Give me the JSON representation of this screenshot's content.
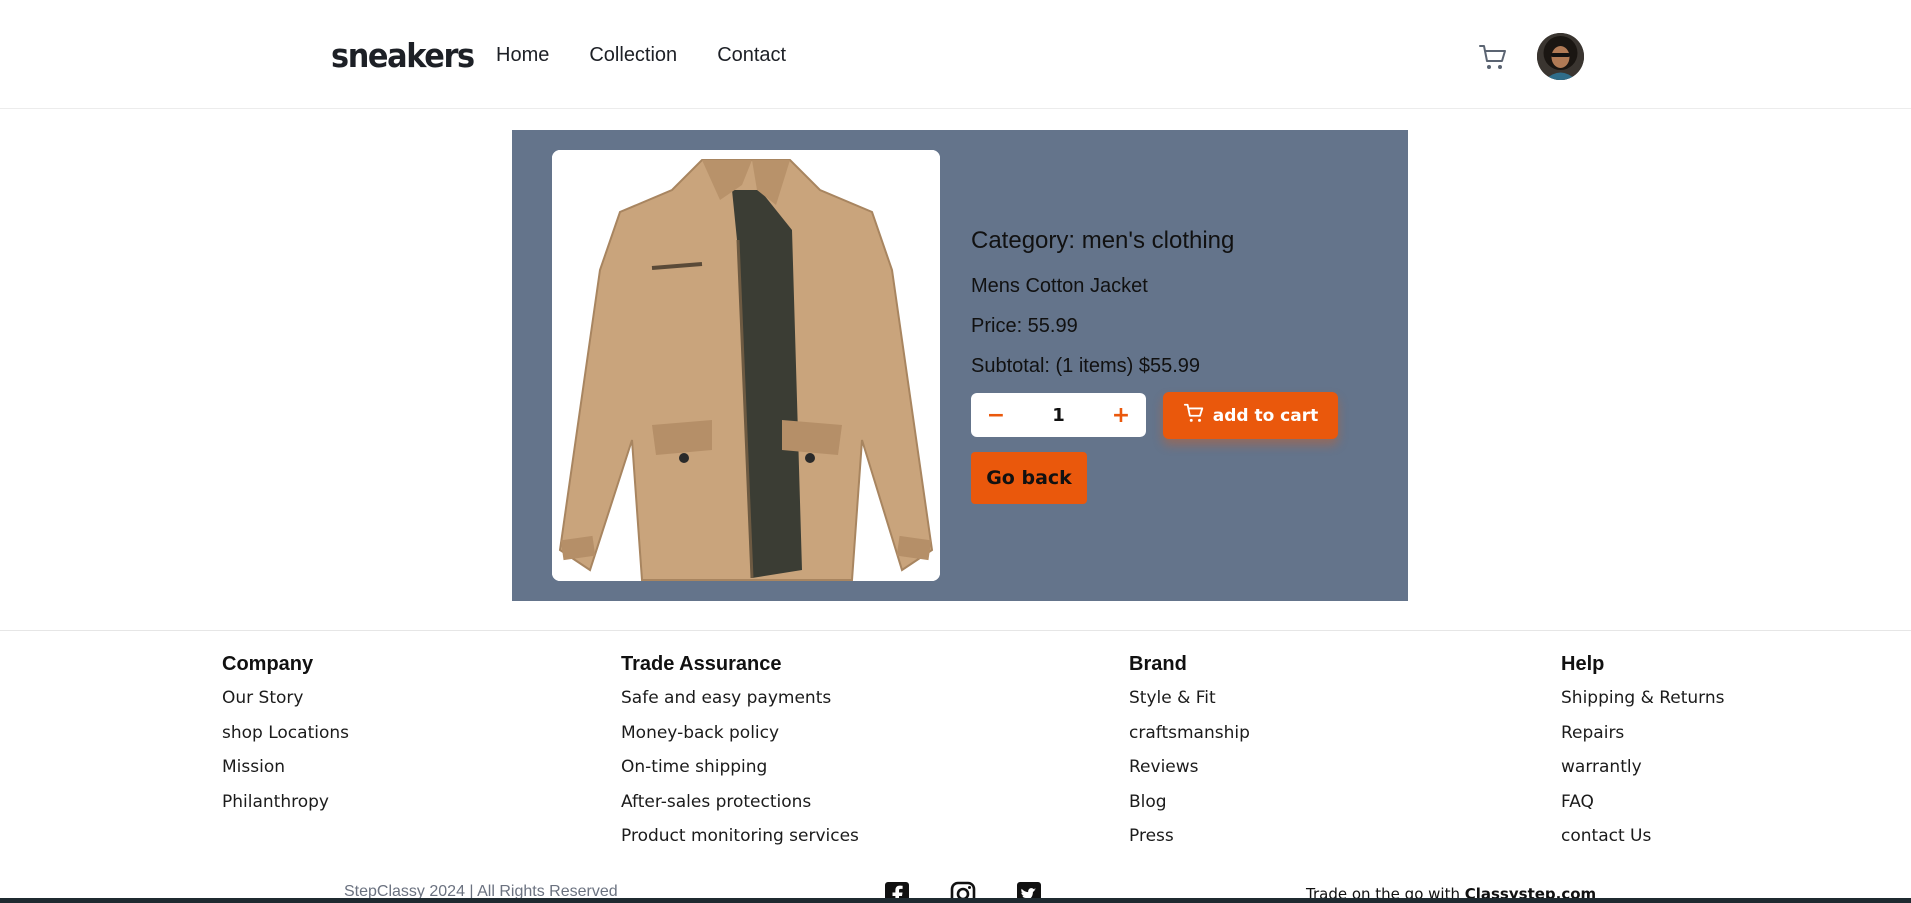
{
  "header": {
    "logo": "sneakers",
    "nav": [
      "Home",
      "Collection",
      "Contact"
    ]
  },
  "product": {
    "category": "Category: men's clothing",
    "title": "Mens Cotton Jacket",
    "price": "Price: 55.99",
    "subtotal": "Subtotal: (1 items) $55.99",
    "quantity": "1",
    "minus": "−",
    "plus": "+",
    "add_to_cart": "add to cart",
    "go_back": "Go back"
  },
  "footer": {
    "company": {
      "title": "Company",
      "items": [
        "Our Story",
        "shop Locations",
        "Mission",
        "Philanthropy"
      ]
    },
    "trade": {
      "title": "Trade Assurance",
      "items": [
        "Safe and easy payments",
        "Money-back policy",
        "On-time shipping",
        "After-sales protections",
        "Product monitoring services"
      ]
    },
    "brand": {
      "title": "Brand",
      "items": [
        "Style & Fit",
        "craftsmanship",
        "Reviews",
        "Blog",
        "Press"
      ]
    },
    "help": {
      "title": "Help",
      "items": [
        "Shipping & Returns",
        "Repairs",
        "warrantly",
        "FAQ",
        "contact Us"
      ]
    },
    "copyright": "StepClassy 2024 | All Rights Reserved",
    "trade_go_prefix": "Trade on the go with ",
    "trade_go_brand": "Classystep.com"
  },
  "colors": {
    "accent": "#ea580c",
    "card_bg": "#64748b"
  },
  "icons": [
    "cart-icon",
    "avatar",
    "facebook-icon",
    "instagram-icon",
    "twitter-icon"
  ]
}
